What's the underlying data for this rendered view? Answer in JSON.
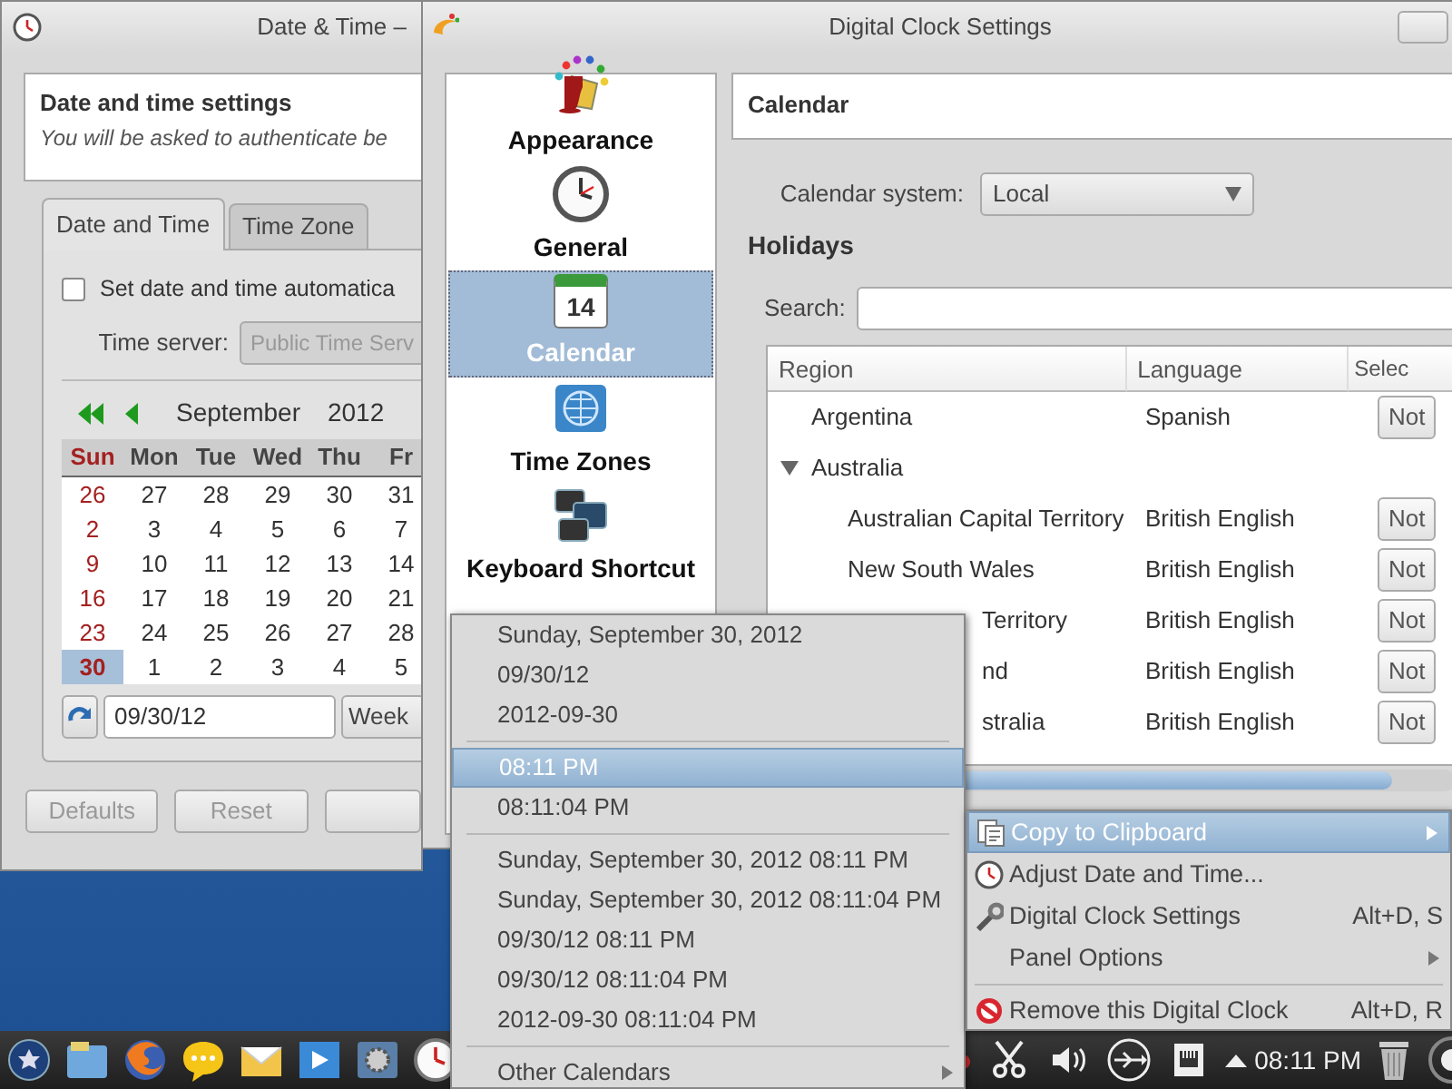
{
  "date_time_window": {
    "title": "Date & Time –",
    "heading": "Date and time settings",
    "subheading": "You will be asked to authenticate be",
    "tabs": [
      {
        "label": "Date and Time",
        "selected": true
      },
      {
        "label": "Time Zone",
        "selected": false
      }
    ],
    "auto_sync": {
      "label": "Set date and time automatica",
      "checked": false
    },
    "time_server": {
      "label": "Time server:",
      "value": "Public Time Serv",
      "disabled": true
    },
    "calendar": {
      "month": "September",
      "year": "2012",
      "weekdays": [
        "Sun",
        "Mon",
        "Tue",
        "Wed",
        "Thu",
        "Fr"
      ],
      "weeks": [
        [
          {
            "day": "26",
            "selected": false
          },
          {
            "day": "27",
            "selected": false
          },
          {
            "day": "28",
            "selected": false
          },
          {
            "day": "29",
            "selected": false
          },
          {
            "day": "30",
            "selected": false
          },
          {
            "day": "31",
            "selected": false
          }
        ],
        [
          {
            "day": "2",
            "selected": false
          },
          {
            "day": "3",
            "selected": false
          },
          {
            "day": "4",
            "selected": false
          },
          {
            "day": "5",
            "selected": false
          },
          {
            "day": "6",
            "selected": false
          },
          {
            "day": "7",
            "selected": false
          }
        ],
        [
          {
            "day": "9",
            "selected": false
          },
          {
            "day": "10",
            "selected": false
          },
          {
            "day": "11",
            "selected": false
          },
          {
            "day": "12",
            "selected": false
          },
          {
            "day": "13",
            "selected": false
          },
          {
            "day": "14",
            "selected": false
          }
        ],
        [
          {
            "day": "16",
            "selected": false
          },
          {
            "day": "17",
            "selected": false
          },
          {
            "day": "18",
            "selected": false
          },
          {
            "day": "19",
            "selected": false
          },
          {
            "day": "20",
            "selected": false
          },
          {
            "day": "21",
            "selected": false
          }
        ],
        [
          {
            "day": "23",
            "selected": false
          },
          {
            "day": "24",
            "selected": false
          },
          {
            "day": "25",
            "selected": false
          },
          {
            "day": "26",
            "selected": false
          },
          {
            "day": "27",
            "selected": false
          },
          {
            "day": "28",
            "selected": false
          }
        ],
        [
          {
            "day": "30",
            "selected": true
          },
          {
            "day": "1",
            "selected": false
          },
          {
            "day": "2",
            "selected": false
          },
          {
            "day": "3",
            "selected": false
          },
          {
            "day": "4",
            "selected": false
          },
          {
            "day": "5",
            "selected": false
          }
        ]
      ]
    },
    "date_field": {
      "value": "09/30/12"
    },
    "week_field": {
      "value": "Week"
    },
    "buttons": [
      {
        "label": "Defaults",
        "disabled": true
      },
      {
        "label": "Reset",
        "disabled": true
      }
    ]
  },
  "clock_settings_window": {
    "title": "Digital Clock Settings",
    "pages": [
      {
        "label": "Appearance",
        "selected": false
      },
      {
        "label": "General",
        "selected": false
      },
      {
        "label": "Calendar",
        "selected": true,
        "icon_text": "14"
      },
      {
        "label": "Time Zones",
        "selected": false
      },
      {
        "label": "Keyboard Shortcut",
        "selected": false
      }
    ],
    "page_title": "Calendar",
    "calendar_system": {
      "label": "Calendar system:",
      "value": "Local"
    },
    "holidays_heading": "Holidays",
    "search": {
      "label": "Search:"
    },
    "holidays_table": {
      "columns": [
        "Region",
        "Language",
        "Selec"
      ],
      "rows": [
        {
          "region": "Argentina",
          "language": "Spanish",
          "selection": "Not"
        },
        {
          "region": "Australia",
          "expanded": true,
          "children": [
            {
              "kind": "full",
              "region": "Australian Capital Territory",
              "language": "British English",
              "selection": "Not"
            },
            {
              "kind": "full",
              "region": "New South Wales",
              "language": "British English",
              "selection": "Not"
            },
            {
              "kind": "covered",
              "region": "Territory",
              "language": "British English",
              "selection": "Not"
            },
            {
              "kind": "covered",
              "region": "nd",
              "language": "British English",
              "selection": "Not"
            },
            {
              "kind": "covered",
              "region": "stralia",
              "language": "British English",
              "selection": "Not"
            }
          ]
        }
      ]
    }
  },
  "copy_submenu": {
    "groups": [
      [
        {
          "label": "Sunday, September 30, 2012",
          "selected": false
        },
        {
          "label": "09/30/12",
          "selected": false
        },
        {
          "label": "2012-09-30",
          "selected": false
        }
      ],
      [
        {
          "label": "08:11 PM",
          "selected": true
        },
        {
          "label": "08:11:04 PM",
          "selected": false
        }
      ],
      [
        {
          "label": "Sunday, September 30, 2012 08:11 PM",
          "selected": false
        },
        {
          "label": "Sunday, September 30, 2012 08:11:04 PM",
          "selected": false
        },
        {
          "label": "09/30/12 08:11 PM",
          "selected": false
        },
        {
          "label": "09/30/12 08:11:04 PM",
          "selected": false
        },
        {
          "label": "2012-09-30 08:11:04 PM",
          "selected": false
        }
      ],
      [
        {
          "label": "Other Calendars",
          "selected": false,
          "submenu": true
        }
      ]
    ]
  },
  "clock_menu": {
    "items": [
      {
        "kind": "item",
        "label": "Copy to Clipboard",
        "selected": true,
        "submenu": true
      },
      {
        "kind": "item",
        "label": "Adjust Date and Time...",
        "selected": false
      },
      {
        "kind": "item",
        "label": "Digital Clock Settings",
        "shortcut": "Alt+D, S",
        "selected": false
      },
      {
        "kind": "item",
        "label": "Panel Options",
        "selected": false,
        "submenu": true
      },
      {
        "kind": "separator"
      },
      {
        "kind": "item",
        "label": "Remove this Digital Clock",
        "shortcut": "Alt+D, R",
        "selected": false
      }
    ]
  },
  "taskbar": {
    "clock": "08:11 PM"
  }
}
